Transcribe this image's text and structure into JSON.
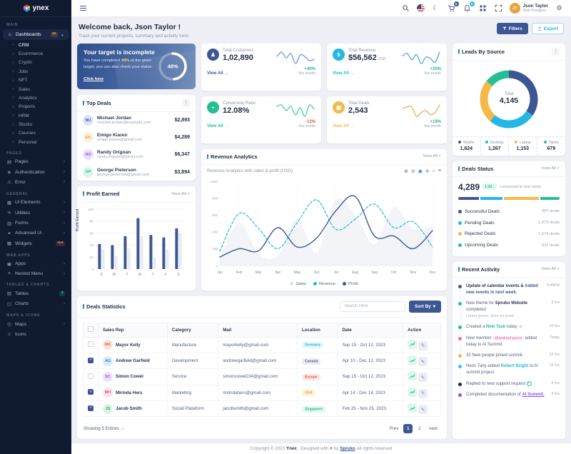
{
  "app": {
    "name": "ynex"
  },
  "header": {
    "user": {
      "name": "Json Taylor",
      "role": "Web Designer",
      "initials": "JT"
    },
    "cart_badge": "5",
    "notification_badge": "5"
  },
  "sidebar": {
    "sections": [
      {
        "label": "MAIN",
        "items": [
          {
            "id": "dashboards",
            "icon": "home-icon",
            "label": "Dashboards",
            "badge": "12",
            "badge_style": "warning",
            "active": true,
            "children": [
              {
                "label": "CRM",
                "active": true
              },
              {
                "label": "Ecommerce"
              },
              {
                "label": "Crypto"
              },
              {
                "label": "Jobs"
              },
              {
                "label": "NFT"
              },
              {
                "label": "Sales"
              },
              {
                "label": "Analytics"
              },
              {
                "label": "Projects"
              },
              {
                "label": "HRM"
              },
              {
                "label": "Stocks"
              },
              {
                "label": "Courses"
              },
              {
                "label": "Personal"
              }
            ]
          }
        ]
      },
      {
        "label": "PAGES",
        "items": [
          {
            "id": "pages",
            "icon": "pages-icon",
            "label": "Pages",
            "chevron": true
          },
          {
            "id": "authentication",
            "icon": "authentication-icon",
            "label": "Authentication",
            "chevron": true
          },
          {
            "id": "error",
            "icon": "error-icon",
            "label": "Error",
            "chevron": true
          }
        ]
      },
      {
        "label": "GENERAL",
        "items": [
          {
            "id": "ui-elements",
            "icon": "ui-elements-icon",
            "label": "Ui Elements",
            "chevron": true
          },
          {
            "id": "utilities",
            "icon": "utilities-icon",
            "label": "Utilities",
            "chevron": true
          },
          {
            "id": "forms",
            "icon": "forms-icon",
            "label": "Forms",
            "chevron": true
          },
          {
            "id": "advanced-ui",
            "icon": "advanced-ui-icon",
            "label": "Advanced Ui",
            "chevron": true
          },
          {
            "id": "widgets",
            "icon": "widgets-icon",
            "label": "Widgets",
            "badge": "Hot",
            "badge_style": "danger"
          }
        ]
      },
      {
        "label": "WEB APPS",
        "items": [
          {
            "id": "apps",
            "icon": "apps-icon",
            "label": "Apps",
            "chevron": true
          },
          {
            "id": "nested-menu",
            "icon": "nested-menu-icon",
            "label": "Nested Menu",
            "chevron": true
          }
        ]
      },
      {
        "label": "TABLES & CHARTS",
        "items": [
          {
            "id": "tables",
            "icon": "tables-icon",
            "label": "Tables",
            "badge": "3",
            "badge_style": "success"
          },
          {
            "id": "charts",
            "icon": "charts-icon",
            "label": "Charts",
            "chevron": true
          }
        ]
      },
      {
        "label": "MAPS & ICONS",
        "items": [
          {
            "id": "maps",
            "icon": "maps-icon",
            "label": "Maps",
            "chevron": true
          },
          {
            "id": "icons",
            "icon": "icons-icon",
            "label": "Icons"
          }
        ]
      }
    ]
  },
  "welcome": {
    "title": "Welcome back, Json Taylor !",
    "subtitle": "Track your current projects, summary and activity here.",
    "filters_label": "Filters",
    "export_label": "Export"
  },
  "banner": {
    "title": "Your target is incomplete",
    "body_prefix": "You have completed ",
    "highlight": "48%",
    "body_suffix": " of the given target, you can also check your status.",
    "link": "Click here",
    "progress_percent": 48,
    "progress_label": "48%"
  },
  "stat_cards": [
    {
      "label": "Total Customers",
      "value": "1,02,890",
      "unit": "",
      "change": "+40%",
      "change_dir": "up",
      "period": "this month",
      "link": "View All",
      "accent": "#3d5795",
      "spark_color": "#6b8fd8",
      "icon": "users-icon",
      "spark": [
        10,
        13,
        9,
        12,
        5,
        11,
        10,
        7,
        8
      ]
    },
    {
      "label": "Total Revenue",
      "value": "$56,562",
      "unit": "USD",
      "change": "+25%",
      "change_dir": "up",
      "period": "this month",
      "link": "View All",
      "accent": "#23b7e5",
      "spark_color": "#49a0e0",
      "icon": "revenue-icon",
      "spark": [
        10,
        12,
        7,
        11,
        4,
        9,
        8,
        5,
        13
      ]
    },
    {
      "label": "Conversion Ratio",
      "value": "12.08%",
      "unit": "",
      "change": "-12%",
      "change_dir": "down",
      "period": "this month",
      "link": "View All",
      "accent": "#26bf94",
      "spark_color": "#3fc6a0",
      "icon": "conversion-icon",
      "spark": [
        11,
        12,
        8,
        11,
        5,
        10,
        4,
        12,
        9
      ]
    },
    {
      "label": "Total Deals",
      "value": "2,543",
      "unit": "",
      "change": "+19%",
      "change_dir": "up",
      "period": "this month",
      "link": "View All",
      "accent": "#f5b849",
      "spark_color": "#e0ab55",
      "icon": "deals-icon",
      "spark": [
        10,
        11,
        11,
        6,
        8,
        9,
        7,
        8,
        12
      ]
    }
  ],
  "top_deals": {
    "title": "Top Deals",
    "items": [
      {
        "name": "Michael Jordan",
        "email": "michael.jordan@example.com",
        "amount": "$2,893",
        "initials": "MJ",
        "avatar_bg": "#dbe4f5",
        "avatar_color": "#3d5795"
      },
      {
        "name": "Emigo Kiaren",
        "email": "emigo.kiaren@gmail.com",
        "amount": "$4,289",
        "initials": "EK",
        "avatar_bg": "#fdf0dc",
        "avatar_color": "#e8a23d"
      },
      {
        "name": "Randy Origoan",
        "email": "randy.origoan@gmail.com",
        "amount": "$6,347",
        "initials": "RO",
        "avatar_bg": "#e8e1f7",
        "avatar_color": "#8e54e9"
      },
      {
        "name": "George Pieterson",
        "email": "george.pieterson@gmail.com",
        "amount": "$3,894",
        "initials": "GP",
        "avatar_bg": "#def5ec",
        "avatar_color": "#26bf94"
      }
    ]
  },
  "profit_earned": {
    "title": "Profit Earned",
    "view_all": "View All",
    "chart": {
      "type": "bar",
      "categories": [
        "S",
        "M",
        "T",
        "W",
        "T",
        "F",
        "S"
      ],
      "series": [
        {
          "name": "Profit",
          "color": "#3d5795",
          "values": [
            42,
            40,
            55,
            85,
            57,
            53,
            68
          ]
        },
        {
          "name": "Previous",
          "color": "#e9ebf3",
          "values": [
            33,
            22,
            35,
            55,
            20,
            34,
            60
          ]
        }
      ],
      "ylabel": "Profit Earned",
      "yticks": [
        0,
        20,
        40,
        60,
        80,
        100
      ],
      "ylim": [
        0,
        100
      ]
    }
  },
  "revenue_analytics": {
    "title": "Revenue Analytics",
    "view_all": "View All",
    "subtitle": "Revenue Analytics with sales & profit (USD)",
    "toolbar": [
      "zoom-in-icon",
      "zoom-out-icon",
      "selection-zoom-icon",
      "pan-icon",
      "reset-zoom-icon",
      "menu-icon"
    ],
    "chart": {
      "type": "line",
      "x": [
        "Jan",
        "Feb",
        "Mar",
        "Apr",
        "May",
        "Jun",
        "Jul",
        "Aug",
        "Sep",
        "Oct",
        "Nov",
        "Dec"
      ],
      "yticks": [
        0,
        200,
        400,
        600,
        800,
        1000
      ],
      "ylim": [
        0,
        1000
      ],
      "series": [
        {
          "name": "Sales",
          "type": "area",
          "color": "#eceef2",
          "values": [
            90,
            510,
            140,
            120,
            550,
            150,
            780,
            600,
            250,
            690,
            430,
            470
          ]
        },
        {
          "name": "Revenue",
          "type": "dashed",
          "color": "#23b7e5",
          "values": [
            170,
            620,
            440,
            200,
            510,
            780,
            430,
            550,
            730,
            450,
            520,
            220
          ]
        },
        {
          "name": "Profit",
          "type": "solid",
          "color": "#3d5795",
          "values": [
            100,
            200,
            175,
            450,
            220,
            325,
            650,
            820,
            350,
            350,
            200,
            415
          ]
        }
      ],
      "legend": [
        {
          "label": "Sales",
          "color": "#e0e2ea"
        },
        {
          "label": "Revenue",
          "color": "#23b7e5"
        },
        {
          "label": "Profit",
          "color": "#3d5795"
        }
      ]
    }
  },
  "leads_by_source": {
    "title": "Leads By Source",
    "center_label": "Total",
    "center_value": "4,145",
    "chart": {
      "type": "donut",
      "slices": [
        {
          "label": "Mobile",
          "value": 1624,
          "display": "1,624",
          "color": "#3d5795"
        },
        {
          "label": "Desktop",
          "value": 1267,
          "display": "1,267",
          "color": "#23b7e5"
        },
        {
          "label": "Laptop",
          "value": 1153,
          "display": "1,153",
          "color": "#f5b849"
        },
        {
          "label": "Tablet",
          "value": 679,
          "display": "679",
          "color": "#26bf94"
        }
      ]
    }
  },
  "deals_status": {
    "title": "Deals Status",
    "view_all": "View All",
    "total": "4,289",
    "badge": "1.02",
    "compare_text": "compared to last week",
    "items": [
      {
        "label": "Successful Deals",
        "value": "987 deals",
        "num": 987,
        "color": "#3d5795"
      },
      {
        "label": "Pending Deals",
        "value": "1,073 deals",
        "num": 1073,
        "color": "#23b7e5"
      },
      {
        "label": "Rejected Deals",
        "value": "1,674 deals",
        "num": 1674,
        "color": "#f5b849"
      },
      {
        "label": "Upcoming Deals",
        "value": "921 deals",
        "num": 921,
        "color": "#26bf94"
      }
    ]
  },
  "recent_activity": {
    "title": "Recent Activity",
    "view_all": "View All",
    "items": [
      {
        "dot": "#3d5795",
        "time": "4:45PM",
        "parts": [
          {
            "t": "Update of calendar events & ",
            "c": "b"
          },
          {
            "t": "Added new events in next week.",
            "c": "link-primary"
          }
        ]
      },
      {
        "dot": "#23b7e5",
        "time": "3 hrs",
        "parts": [
          {
            "t": "New theme for "
          },
          {
            "t": "Spruko Website",
            "c": "b"
          },
          {
            "t": " completed"
          }
        ],
        "sub": "Lorem ipsum, dolor sit amet."
      },
      {
        "dot": "#26bf94",
        "time": "22 hrs",
        "parts": [
          {
            "t": "Created a "
          },
          {
            "t": "New Task",
            "c": "link-green"
          },
          {
            "t": " today "
          },
          {
            "icon": "mini-avatar"
          }
        ]
      },
      {
        "dot": "#ec6aa0",
        "time": "Today",
        "parts": [
          {
            "t": "New member "
          },
          {
            "t": "@andriod.gurus",
            "c": "badge-pink"
          },
          {
            "t": " added today to AI Summit."
          }
        ]
      },
      {
        "dot": "#f5b849",
        "time": "22 hrs",
        "parts": [
          {
            "t": "32 New people joined summit."
          }
        ]
      },
      {
        "dot": "#38bdf8",
        "time": "12 hrs",
        "parts": [
          {
            "t": "Neon Tarly added "
          },
          {
            "t": "Robert Bright",
            "c": "link-cyan"
          },
          {
            "t": " to AI summit project."
          }
        ]
      },
      {
        "dot": "#1c273c",
        "time": "4 hrs",
        "parts": [
          {
            "t": "Replied to new support request "
          },
          {
            "icon": "check-circle"
          }
        ]
      },
      {
        "dot": "#8e54e9",
        "time": "4 hrs",
        "parts": [
          {
            "t": "Completed documentation of "
          },
          {
            "t": "AI Summit.",
            "c": "link-purple"
          }
        ]
      }
    ]
  },
  "deals_table": {
    "title": "Deals Statistics",
    "search_placeholder": "Search Here",
    "sort_label": "Sort By",
    "columns": [
      "Sales Rep",
      "Category",
      "Mail",
      "Location",
      "Date",
      "Action"
    ],
    "rows": [
      {
        "checked": false,
        "name": "Mayor Kelly",
        "initials": "MK",
        "avatar_bg": "#fde3d8",
        "avatar_color": "#d97555",
        "category": "Manufacture",
        "mail": "mayorkelly@gmail.com",
        "location": "Germany",
        "loc_style": "cyan",
        "date": "Sep 15 - Oct 12, 2023"
      },
      {
        "checked": true,
        "name": "Andrew Garfield",
        "initials": "AG",
        "avatar_bg": "#d8ecfb",
        "avatar_color": "#3d83c4",
        "category": "Development",
        "mail": "andrewgarfield@gmail.com",
        "location": "Canada",
        "loc_style": "slate",
        "date": "Apr 10 - Dec 12, 2023"
      },
      {
        "checked": false,
        "name": "Simon Cowel",
        "initials": "SC",
        "avatar_bg": "#eee2fb",
        "avatar_color": "#8e54e9",
        "category": "Service",
        "mail": "simoncowel234@gmail.com",
        "location": "Europe",
        "loc_style": "red",
        "date": "Sep 15 - Oct 12, 2023"
      },
      {
        "checked": true,
        "name": "Mirinda Hers",
        "initials": "MH",
        "avatar_bg": "#fde2ec",
        "avatar_color": "#d95587",
        "category": "Marketing",
        "mail": "mirindahers@gmail.com",
        "location": "USA",
        "loc_style": "orange",
        "date": "Apr 14 - Dec 14, 2023"
      },
      {
        "checked": true,
        "name": "Jacob Smith",
        "initials": "JS",
        "avatar_bg": "#ddf2e6",
        "avatar_color": "#2f9e6e",
        "category": "Social Plataform",
        "mail": "jacobsmith@gmail.com",
        "location": "Singapore",
        "loc_style": "green",
        "date": "Feb 25 - Nov 25, 2023"
      }
    ],
    "showing_text": "Showing 5 Entries",
    "pagination": {
      "prev": "Prev",
      "pages": [
        "1",
        "2"
      ],
      "active": "1",
      "next": "next"
    }
  },
  "footer": {
    "parts": [
      {
        "t": "Copyright © 2023 "
      },
      {
        "t": "Ynex",
        "c": "b"
      },
      {
        "t": ". Designed with "
      },
      {
        "t": "♥",
        "c": "heart"
      },
      {
        "t": " by "
      },
      {
        "t": "Spruko",
        "c": "link"
      },
      {
        "t": " All rights reserved"
      }
    ]
  }
}
